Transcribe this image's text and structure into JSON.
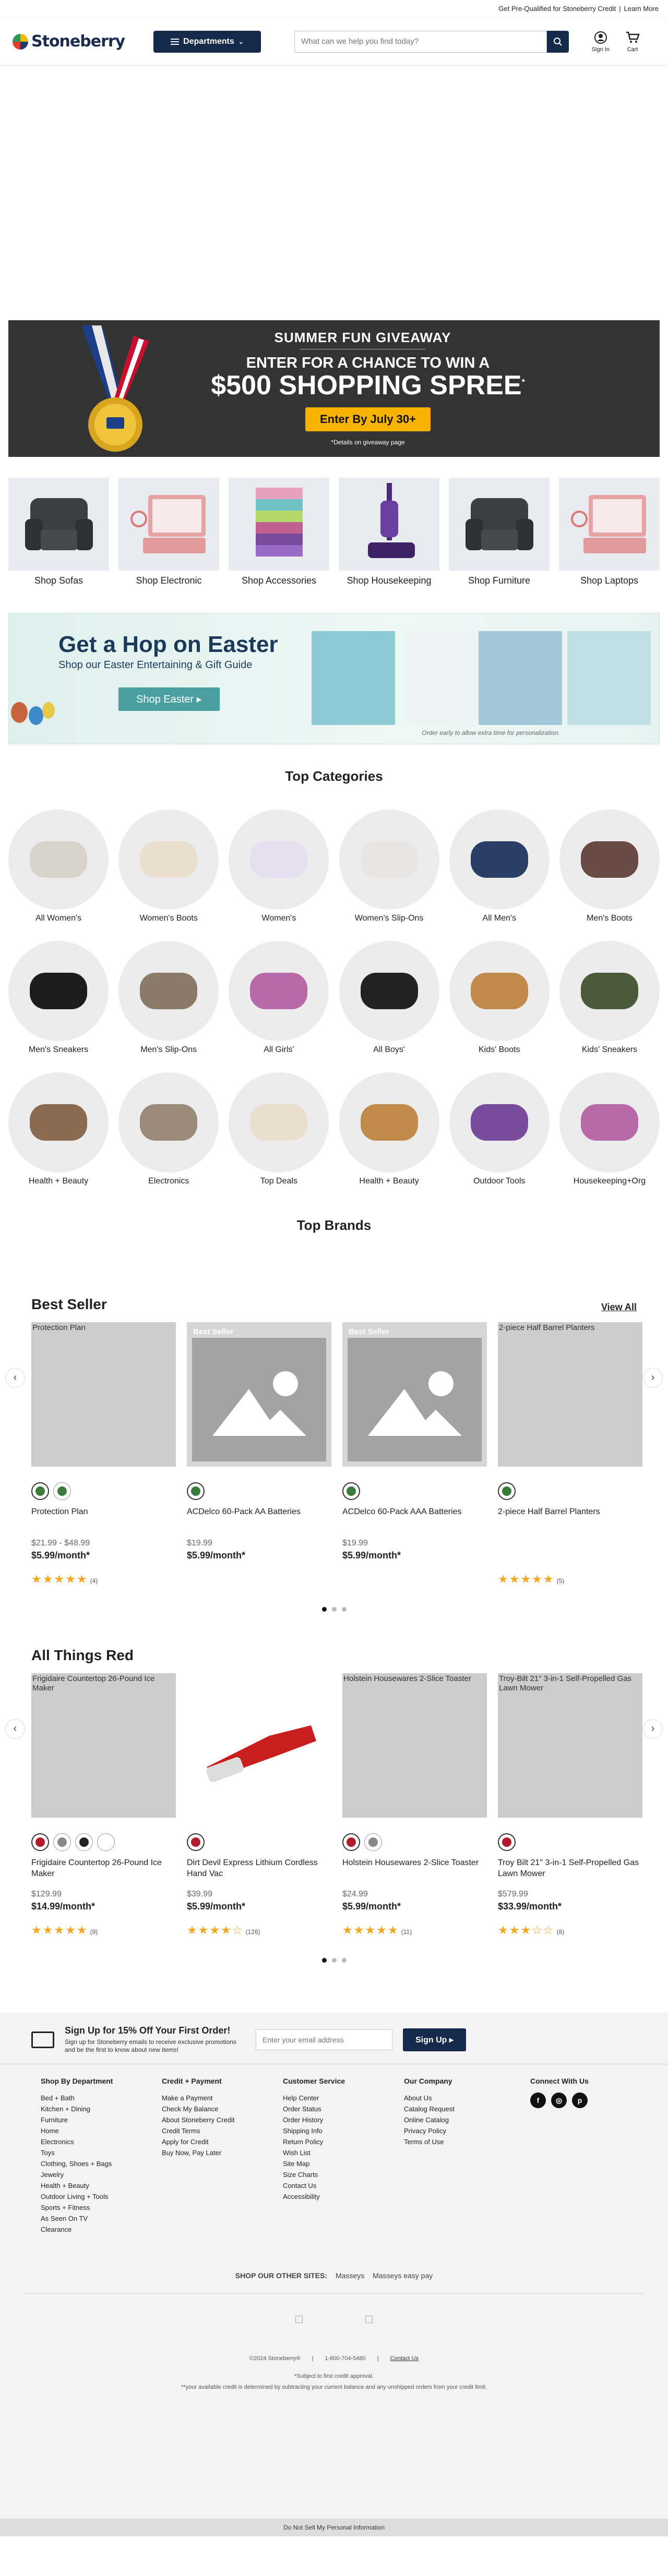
{
  "topbar": {
    "text": "Get Pre-Qualified for Stoneberry Credit",
    "sep": "|",
    "link": "Learn More"
  },
  "header": {
    "logo": "Stoneberry",
    "departments": "Departments",
    "search_placeholder": "What can we help you find today?",
    "signin": "Sign In",
    "cart": "Cart"
  },
  "giveaway": {
    "title": "SUMMER FUN GIVEAWAY",
    "line1": "ENTER FOR A CHANCE TO WIN A",
    "line2": "$500 SHOPPING SPREE",
    "sup": "*",
    "button": "Enter By July 30+",
    "note": "*Details on giveaway page"
  },
  "shop_tiles": [
    {
      "label": "Shop Sofas",
      "icon": "recliner-image"
    },
    {
      "label": "Shop Electronic",
      "icon": "tablet-image"
    },
    {
      "label": "Shop Accessories",
      "icon": "towels-image"
    },
    {
      "label": "Shop Housekeeping",
      "icon": "vacuum-image"
    },
    {
      "label": "Shop Furniture",
      "icon": "recliner-image"
    },
    {
      "label": "Shop Laptops",
      "icon": "tablet-image"
    }
  ],
  "easter": {
    "title": "Get a Hop on Easter",
    "subtitle": "Shop our Easter Entertaining & Gift Guide",
    "button": "Shop Easter ▸",
    "note": "Order early to allow extra time for personalization."
  },
  "top_categories": {
    "title": "Top Categories",
    "items": [
      "All Women's",
      "Women's Boots",
      "Women's",
      "Women's Slip-Ons",
      "All Men's",
      "Men's Boots",
      "Men's Sneakers",
      "Men's Slip-Ons",
      "All Girls'",
      "All Boys'",
      "Kids' Boots",
      "Kids' Sneakers",
      "Health + Beauty",
      "Electronics",
      "Top Deals",
      "Health + Beauty",
      "Outdoor Tools",
      "Housekeeping+Org"
    ]
  },
  "top_brands": {
    "title": "Top Brands"
  },
  "best_seller": {
    "title": "Best Seller",
    "view_all": "View All",
    "products": [
      {
        "alt": "Protection Plan",
        "badge": "",
        "name": "Protection Plan",
        "price": "$21.99 - $48.99",
        "monthly": "$5.99/month*",
        "stars": "★★★★★",
        "count": "(4)"
      },
      {
        "alt": "",
        "badge": "Best Seller",
        "name": "ACDelco 60-Pack AA Batteries",
        "price": "$19.99",
        "monthly": "$5.99/month*",
        "stars": "",
        "count": ""
      },
      {
        "alt": "",
        "badge": "Best Seller",
        "name": "ACDelco 60-Pack AAA Batteries",
        "price": "$19.99",
        "monthly": "$5.99/month*",
        "stars": "",
        "count": ""
      },
      {
        "alt": "2-piece Half Barrel Planters",
        "badge": "",
        "name": "2-piece Half Barrel Planters",
        "price": "",
        "monthly": "",
        "stars": "★★★★★",
        "count": "(5)"
      }
    ]
  },
  "all_things_red": {
    "title": "All Things Red",
    "products": [
      {
        "alt": "Frigidaire Countertop 26-Pound Ice Maker",
        "name": "Frigidaire Countertop 26-Pound Ice Maker",
        "price": "$129.99",
        "monthly": "$14.99/month*",
        "stars": "★★★★★",
        "count": "(9)"
      },
      {
        "alt": "",
        "name": "Dirt Devil Express Lithium Cordless Hand Vac",
        "price": "$39.99",
        "monthly": "$5.99/month*",
        "stars": "★★★★☆",
        "count": "(126)"
      },
      {
        "alt": "Holstein Housewares 2-Slice Toaster",
        "name": "Holstein Housewares 2-Slice Toaster",
        "price": "$24.99",
        "monthly": "$5.99/month*",
        "stars": "★★★★★",
        "count": "(11)"
      },
      {
        "alt": "Troy-Bilt 21\" 3-in-1 Self-Propelled Gas Lawn Mower",
        "name": "Troy Bilt 21\" 3-in-1 Self-Propelled Gas Lawn Mower",
        "price": "$579.99",
        "monthly": "$33.99/month*",
        "stars": "★★★☆☆",
        "count": "(8)"
      }
    ]
  },
  "footer": {
    "signup_title": "Sign Up for 15% Off Your First Order!",
    "signup_text": "Sign up for Stoneberry emails to receive exclusive promotions and be the first to know about new items!",
    "email_placeholder": "Enter your email address",
    "signup_button": "Sign Up ▸",
    "columns": [
      {
        "title": "Shop By Department",
        "links": [
          "Bed + Bath",
          "Kitchen + Dining",
          "Furniture",
          "Home",
          "Electronics",
          "Toys",
          "Clothing, Shoes + Bags",
          "Jewelry",
          "Health + Beauty",
          "Outdoor Living + Tools",
          "Sports + Fitness",
          "As Seen On TV",
          "Clearance"
        ]
      },
      {
        "title": "Credit + Payment",
        "links": [
          "Make a Payment",
          "Check My Balance",
          "About Stoneberry Credit",
          "Credit Terms",
          "Apply for Credit",
          "Buy Now, Pay Later"
        ]
      },
      {
        "title": "Customer Service",
        "links": [
          "Help Center",
          "Order Status",
          "Order History",
          "Shipping Info",
          "Return Policy",
          "Wish List",
          "Site Map",
          "Size Charts",
          "Contact Us",
          "Accessibility"
        ]
      },
      {
        "title": "Our Company",
        "links": [
          "About Us",
          "Catalog Request",
          "Online Catalog",
          "Privacy Policy",
          "Terms of Use"
        ]
      }
    ],
    "connect": "Connect With Us",
    "other_sites": "SHOP OUR OTHER SITES:",
    "site1": "Masseys",
    "site2": "Masseys easy pay",
    "copyright": "©2024 Stoneberry®",
    "phone": "1-800-704-5480",
    "contact": "Contact Us",
    "fine1": "*Subject to first credit approval.",
    "fine2": "**your available credit is determined by subtracting your current balance and any unshipped orders from your credit limit.",
    "dns": "Do Not Sell My Personal Information"
  }
}
